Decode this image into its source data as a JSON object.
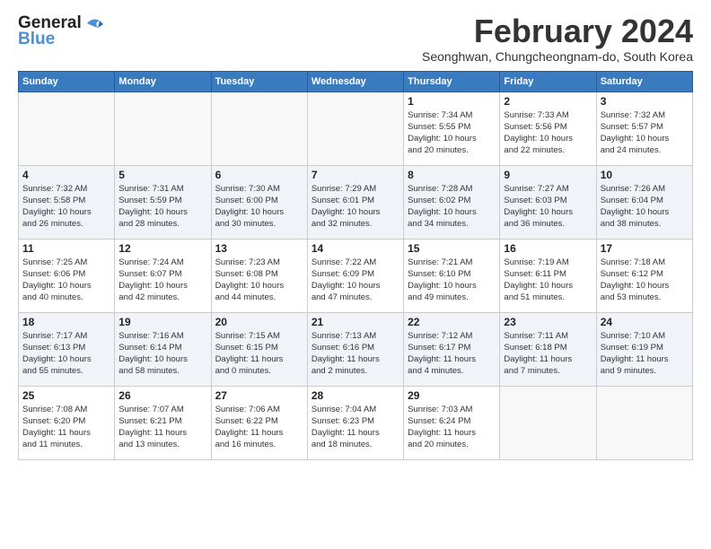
{
  "header": {
    "logo_line1": "General",
    "logo_line2": "Blue",
    "month_title": "February 2024",
    "subtitle": "Seonghwan, Chungcheongnam-do, South Korea"
  },
  "days_of_week": [
    "Sunday",
    "Monday",
    "Tuesday",
    "Wednesday",
    "Thursday",
    "Friday",
    "Saturday"
  ],
  "weeks": [
    [
      {
        "day": "",
        "info": ""
      },
      {
        "day": "",
        "info": ""
      },
      {
        "day": "",
        "info": ""
      },
      {
        "day": "",
        "info": ""
      },
      {
        "day": "1",
        "info": "Sunrise: 7:34 AM\nSunset: 5:55 PM\nDaylight: 10 hours\nand 20 minutes."
      },
      {
        "day": "2",
        "info": "Sunrise: 7:33 AM\nSunset: 5:56 PM\nDaylight: 10 hours\nand 22 minutes."
      },
      {
        "day": "3",
        "info": "Sunrise: 7:32 AM\nSunset: 5:57 PM\nDaylight: 10 hours\nand 24 minutes."
      }
    ],
    [
      {
        "day": "4",
        "info": "Sunrise: 7:32 AM\nSunset: 5:58 PM\nDaylight: 10 hours\nand 26 minutes."
      },
      {
        "day": "5",
        "info": "Sunrise: 7:31 AM\nSunset: 5:59 PM\nDaylight: 10 hours\nand 28 minutes."
      },
      {
        "day": "6",
        "info": "Sunrise: 7:30 AM\nSunset: 6:00 PM\nDaylight: 10 hours\nand 30 minutes."
      },
      {
        "day": "7",
        "info": "Sunrise: 7:29 AM\nSunset: 6:01 PM\nDaylight: 10 hours\nand 32 minutes."
      },
      {
        "day": "8",
        "info": "Sunrise: 7:28 AM\nSunset: 6:02 PM\nDaylight: 10 hours\nand 34 minutes."
      },
      {
        "day": "9",
        "info": "Sunrise: 7:27 AM\nSunset: 6:03 PM\nDaylight: 10 hours\nand 36 minutes."
      },
      {
        "day": "10",
        "info": "Sunrise: 7:26 AM\nSunset: 6:04 PM\nDaylight: 10 hours\nand 38 minutes."
      }
    ],
    [
      {
        "day": "11",
        "info": "Sunrise: 7:25 AM\nSunset: 6:06 PM\nDaylight: 10 hours\nand 40 minutes."
      },
      {
        "day": "12",
        "info": "Sunrise: 7:24 AM\nSunset: 6:07 PM\nDaylight: 10 hours\nand 42 minutes."
      },
      {
        "day": "13",
        "info": "Sunrise: 7:23 AM\nSunset: 6:08 PM\nDaylight: 10 hours\nand 44 minutes."
      },
      {
        "day": "14",
        "info": "Sunrise: 7:22 AM\nSunset: 6:09 PM\nDaylight: 10 hours\nand 47 minutes."
      },
      {
        "day": "15",
        "info": "Sunrise: 7:21 AM\nSunset: 6:10 PM\nDaylight: 10 hours\nand 49 minutes."
      },
      {
        "day": "16",
        "info": "Sunrise: 7:19 AM\nSunset: 6:11 PM\nDaylight: 10 hours\nand 51 minutes."
      },
      {
        "day": "17",
        "info": "Sunrise: 7:18 AM\nSunset: 6:12 PM\nDaylight: 10 hours\nand 53 minutes."
      }
    ],
    [
      {
        "day": "18",
        "info": "Sunrise: 7:17 AM\nSunset: 6:13 PM\nDaylight: 10 hours\nand 55 minutes."
      },
      {
        "day": "19",
        "info": "Sunrise: 7:16 AM\nSunset: 6:14 PM\nDaylight: 10 hours\nand 58 minutes."
      },
      {
        "day": "20",
        "info": "Sunrise: 7:15 AM\nSunset: 6:15 PM\nDaylight: 11 hours\nand 0 minutes."
      },
      {
        "day": "21",
        "info": "Sunrise: 7:13 AM\nSunset: 6:16 PM\nDaylight: 11 hours\nand 2 minutes."
      },
      {
        "day": "22",
        "info": "Sunrise: 7:12 AM\nSunset: 6:17 PM\nDaylight: 11 hours\nand 4 minutes."
      },
      {
        "day": "23",
        "info": "Sunrise: 7:11 AM\nSunset: 6:18 PM\nDaylight: 11 hours\nand 7 minutes."
      },
      {
        "day": "24",
        "info": "Sunrise: 7:10 AM\nSunset: 6:19 PM\nDaylight: 11 hours\nand 9 minutes."
      }
    ],
    [
      {
        "day": "25",
        "info": "Sunrise: 7:08 AM\nSunset: 6:20 PM\nDaylight: 11 hours\nand 11 minutes."
      },
      {
        "day": "26",
        "info": "Sunrise: 7:07 AM\nSunset: 6:21 PM\nDaylight: 11 hours\nand 13 minutes."
      },
      {
        "day": "27",
        "info": "Sunrise: 7:06 AM\nSunset: 6:22 PM\nDaylight: 11 hours\nand 16 minutes."
      },
      {
        "day": "28",
        "info": "Sunrise: 7:04 AM\nSunset: 6:23 PM\nDaylight: 11 hours\nand 18 minutes."
      },
      {
        "day": "29",
        "info": "Sunrise: 7:03 AM\nSunset: 6:24 PM\nDaylight: 11 hours\nand 20 minutes."
      },
      {
        "day": "",
        "info": ""
      },
      {
        "day": "",
        "info": ""
      }
    ]
  ]
}
